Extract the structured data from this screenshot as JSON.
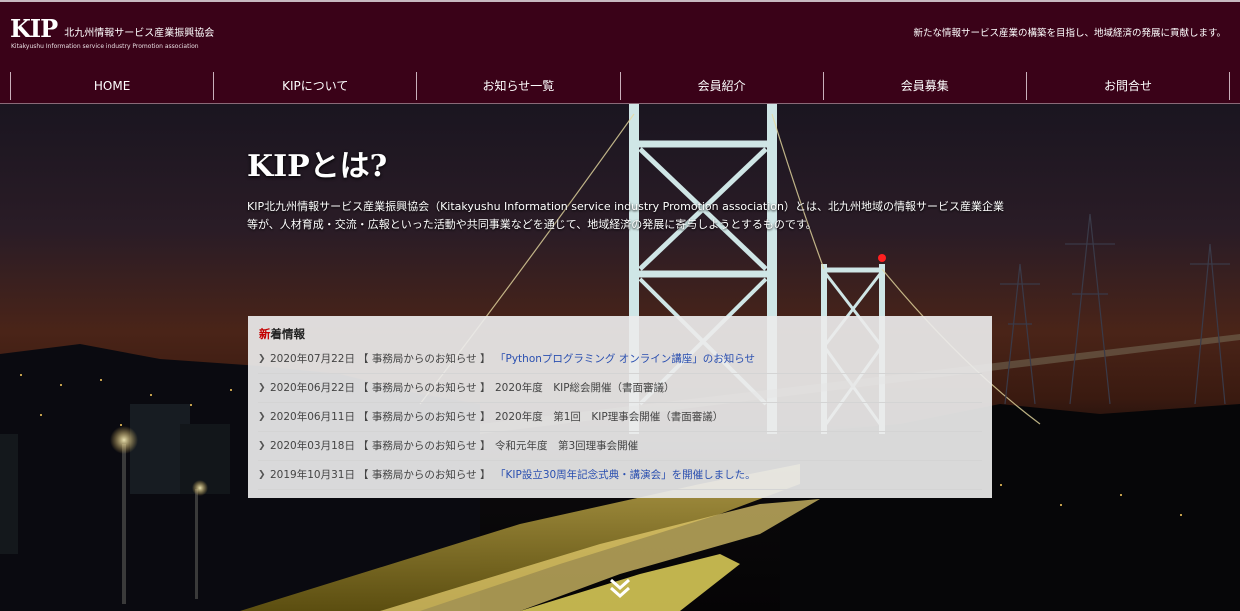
{
  "header": {
    "logo_mark": "KIP",
    "logo_name": "北九州情報サービス産業振興協会",
    "logo_sub": "Kitakyushu Information service industry Promotion association",
    "tagline": "新たな情報サービス産業の構築を目指し、地域経済の発展に貢献します。"
  },
  "nav": {
    "items": [
      {
        "label": "HOME"
      },
      {
        "label": "KIPについて"
      },
      {
        "label": "お知らせ一覧"
      },
      {
        "label": "会員紹介"
      },
      {
        "label": "会員募集"
      },
      {
        "label": "お問合せ"
      }
    ]
  },
  "hero": {
    "title": "KIPとは?",
    "description": "KIP北九州情報サービス産業振興協会（Kitakyushu Information service industry Promotion association）とは、北九州地域の情報サービス産業企業等が、人材育成・交流・広報といった活動や共同事業などを通じて、地域経済の発展に寄与しようとするものです。"
  },
  "news": {
    "title_first": "新",
    "title_rest": "着情報",
    "items": [
      {
        "date": "2020年07月22日",
        "category": "【 事務局からのお知らせ 】",
        "subject": "「Pythonプログラミング オンライン講座」のお知らせ",
        "link": true
      },
      {
        "date": "2020年06月22日",
        "category": "【 事務局からのお知らせ 】",
        "subject": "2020年度　KIP総会開催（書面審議）",
        "link": false
      },
      {
        "date": "2020年06月11日",
        "category": "【 事務局からのお知らせ 】",
        "subject": "2020年度　第1回　KIP理事会開催（書面審議）",
        "link": false
      },
      {
        "date": "2020年03月18日",
        "category": "【 事務局からのお知らせ 】",
        "subject": "令和元年度　第3回理事会開催",
        "link": false
      },
      {
        "date": "2019年10月31日",
        "category": "【 事務局からのお知らせ 】",
        "subject": "「KIP設立30周年記念式典・講演会」を開催しました。",
        "link": true
      }
    ]
  },
  "icons": {
    "chevron": "chevron-right-icon",
    "scroll": "double-chevron-down-icon"
  },
  "colors": {
    "header_bg": "#3a0218",
    "link": "#2a4fb0",
    "accent_red": "#c40000"
  }
}
